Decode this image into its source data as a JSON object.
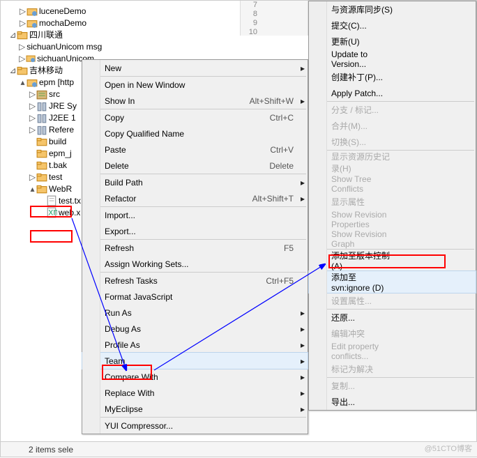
{
  "tree": {
    "items": [
      {
        "indent": 1,
        "twist": "▷",
        "icon": "project",
        "label": "luceneDemo"
      },
      {
        "indent": 1,
        "twist": "▷",
        "icon": "project",
        "label": "mochaDemo"
      },
      {
        "indent": 0,
        "twist": "⊿",
        "icon": "folder",
        "label": "四川联通"
      },
      {
        "indent": 1,
        "twist": "▷",
        "icon": "project",
        "label": "sichuanUnicom msg"
      },
      {
        "indent": 1,
        "twist": "▷",
        "icon": "project",
        "label": "sichuanUnicom"
      },
      {
        "indent": 0,
        "twist": "⊿",
        "icon": "folder",
        "label": "吉林移动"
      },
      {
        "indent": 1,
        "twist": "▴",
        "icon": "project",
        "label": "epm [http"
      },
      {
        "indent": 2,
        "twist": "▷",
        "icon": "src",
        "label": "src"
      },
      {
        "indent": 2,
        "twist": "▷",
        "icon": "lib",
        "label": "JRE Sy"
      },
      {
        "indent": 2,
        "twist": "▷",
        "icon": "lib",
        "label": "J2EE 1"
      },
      {
        "indent": 2,
        "twist": "▷",
        "icon": "lib",
        "label": "Refere"
      },
      {
        "indent": 2,
        "twist": "",
        "icon": "folder",
        "label": "build"
      },
      {
        "indent": 2,
        "twist": "",
        "icon": "folder",
        "label": "epm_j"
      },
      {
        "indent": 2,
        "twist": "",
        "icon": "folder",
        "label": "t.bak"
      },
      {
        "indent": 2,
        "twist": "▷",
        "icon": "folder",
        "label": "test"
      },
      {
        "indent": 2,
        "twist": "▴",
        "icon": "folder",
        "label": "WebR"
      },
      {
        "indent": 3,
        "twist": "",
        "icon": "file",
        "label": "test.tx"
      },
      {
        "indent": 3,
        "twist": "",
        "icon": "xml",
        "label": "web.x"
      }
    ]
  },
  "gutter": {
    "lines": [
      "7",
      "8",
      "9",
      "10"
    ]
  },
  "menu_left": [
    {
      "type": "item",
      "label": "New",
      "arrow": true
    },
    {
      "type": "sep"
    },
    {
      "type": "item",
      "label": "Open in New Window"
    },
    {
      "type": "item",
      "label": "Show In",
      "short": "Alt+Shift+W",
      "arrow": true
    },
    {
      "type": "sep"
    },
    {
      "type": "item",
      "label": "Copy",
      "short": "Ctrl+C",
      "icon": "copy"
    },
    {
      "type": "item",
      "label": "Copy Qualified Name",
      "icon": "copyq"
    },
    {
      "type": "item",
      "label": "Paste",
      "short": "Ctrl+V",
      "icon": "paste"
    },
    {
      "type": "item",
      "label": "Delete",
      "short": "Delete",
      "icon": "delete"
    },
    {
      "type": "sep"
    },
    {
      "type": "item",
      "label": "Build Path",
      "arrow": true
    },
    {
      "type": "item",
      "label": "Refactor",
      "short": "Alt+Shift+T",
      "arrow": true
    },
    {
      "type": "sep"
    },
    {
      "type": "item",
      "label": "Import...",
      "icon": "import"
    },
    {
      "type": "item",
      "label": "Export...",
      "icon": "export"
    },
    {
      "type": "sep"
    },
    {
      "type": "item",
      "label": "Refresh",
      "short": "F5",
      "icon": "refresh"
    },
    {
      "type": "item",
      "label": "Assign Working Sets..."
    },
    {
      "type": "sep"
    },
    {
      "type": "item",
      "label": "Refresh Tasks",
      "short": "Ctrl+F5"
    },
    {
      "type": "item",
      "label": "Format JavaScript"
    },
    {
      "type": "item",
      "label": "Run As",
      "arrow": true
    },
    {
      "type": "item",
      "label": "Debug As",
      "arrow": true
    },
    {
      "type": "item",
      "label": "Profile As",
      "arrow": true
    },
    {
      "type": "item",
      "label": "Team",
      "arrow": true,
      "hl": true
    },
    {
      "type": "item",
      "label": "Compare With",
      "arrow": true
    },
    {
      "type": "item",
      "label": "Replace With",
      "arrow": true
    },
    {
      "type": "item",
      "label": "MyEclipse",
      "arrow": true,
      "icon": "myeclipse"
    },
    {
      "type": "sep"
    },
    {
      "type": "item",
      "label": "YUI Compressor..."
    }
  ],
  "menu_right": [
    {
      "type": "item",
      "label": "与资源库同步(S)",
      "icon": "sync"
    },
    {
      "type": "item",
      "label": "提交(C)...",
      "icon": "commit"
    },
    {
      "type": "item",
      "label": "更新(U)",
      "icon": "update"
    },
    {
      "type": "item",
      "label": "Update to Version...",
      "icon": "updatev"
    },
    {
      "type": "item",
      "label": "创建补丁(P)..."
    },
    {
      "type": "item",
      "label": "Apply Patch..."
    },
    {
      "type": "sep"
    },
    {
      "type": "item",
      "label": "分支 / 标记...",
      "disabled": true,
      "icon": "branch"
    },
    {
      "type": "item",
      "label": "合并(M)...",
      "disabled": true,
      "icon": "merge"
    },
    {
      "type": "item",
      "label": "切换(S)...",
      "disabled": true
    },
    {
      "type": "sep"
    },
    {
      "type": "item",
      "label": "显示资源历史记录(H)",
      "disabled": true,
      "icon": "history"
    },
    {
      "type": "item",
      "label": "Show Tree Conflicts",
      "disabled": true,
      "icon": "treeconf"
    },
    {
      "type": "item",
      "label": "显示属性",
      "disabled": true,
      "icon": "props"
    },
    {
      "type": "item",
      "label": "Show Revision Properties",
      "disabled": true,
      "icon": "revprops"
    },
    {
      "type": "item",
      "label": "Show Revision Graph",
      "disabled": true,
      "icon": "revgraph"
    },
    {
      "type": "sep"
    },
    {
      "type": "item",
      "label": "添加至版本控制(A)"
    },
    {
      "type": "item",
      "label": "添加至 svn:ignore (D)",
      "hl": true
    },
    {
      "type": "item",
      "label": "设置属性...",
      "disabled": true
    },
    {
      "type": "sep"
    },
    {
      "type": "item",
      "label": "还原..."
    },
    {
      "type": "item",
      "label": "编辑冲突",
      "disabled": true
    },
    {
      "type": "item",
      "label": "Edit property conflicts...",
      "disabled": true
    },
    {
      "type": "item",
      "label": "标记为解决",
      "disabled": true
    },
    {
      "type": "sep"
    },
    {
      "type": "item",
      "label": "复制...",
      "disabled": true,
      "icon": "copy"
    },
    {
      "type": "item",
      "label": "导出..."
    }
  ],
  "status": {
    "text": "2 items sele"
  },
  "watermark": "@51CTO博客"
}
